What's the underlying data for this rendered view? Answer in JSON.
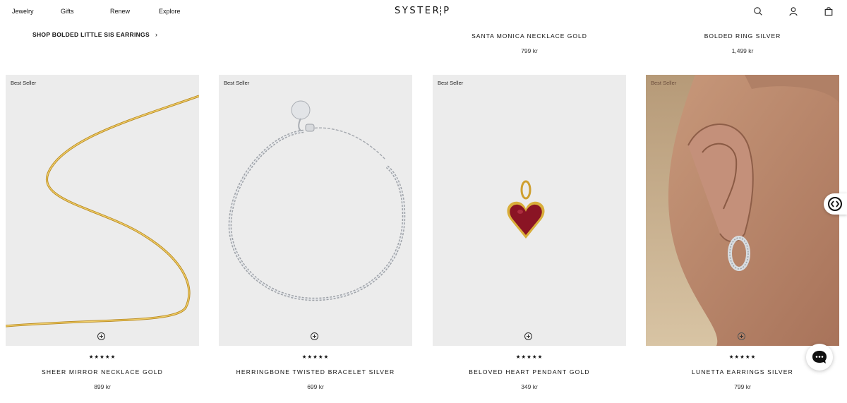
{
  "header": {
    "nav": [
      "Jewelry",
      "Gifts",
      "Renew",
      "Explore"
    ],
    "logo_left": "SYSTER",
    "logo_right": "P",
    "icons": [
      "search-icon",
      "account-icon",
      "bag-icon"
    ]
  },
  "top_row": {
    "shop_link": "SHOP BOLDED LITTLE SIS EARRINGS",
    "chevron": "›",
    "prev_items": [
      {
        "name": "SANTA MONICA NECKLACE GOLD",
        "price": "799 kr"
      },
      {
        "name": "BOLDED RING SILVER",
        "price": "1,499 kr"
      }
    ]
  },
  "products": [
    {
      "badge": "Best Seller",
      "rating": "★★★★★",
      "name": "SHEER MIRROR NECKLACE GOLD",
      "price": "899 kr"
    },
    {
      "badge": "Best Seller",
      "rating": "★★★★★",
      "name": "HERRINGBONE TWISTED BRACELET SILVER",
      "price": "699 kr"
    },
    {
      "badge": "Best Seller",
      "rating": "★★★★★",
      "name": "BELOVED HEART PENDANT GOLD",
      "price": "349 kr"
    },
    {
      "badge": "Best Seller",
      "rating": "★★★★★",
      "name": "LUNETTA EARRINGS SILVER",
      "price": "799 kr"
    }
  ],
  "colors": {
    "gold": "#d9ae3a",
    "silver": "#b8bcc2",
    "heart": "#8a1424",
    "card_bg": "#ebebeb"
  }
}
